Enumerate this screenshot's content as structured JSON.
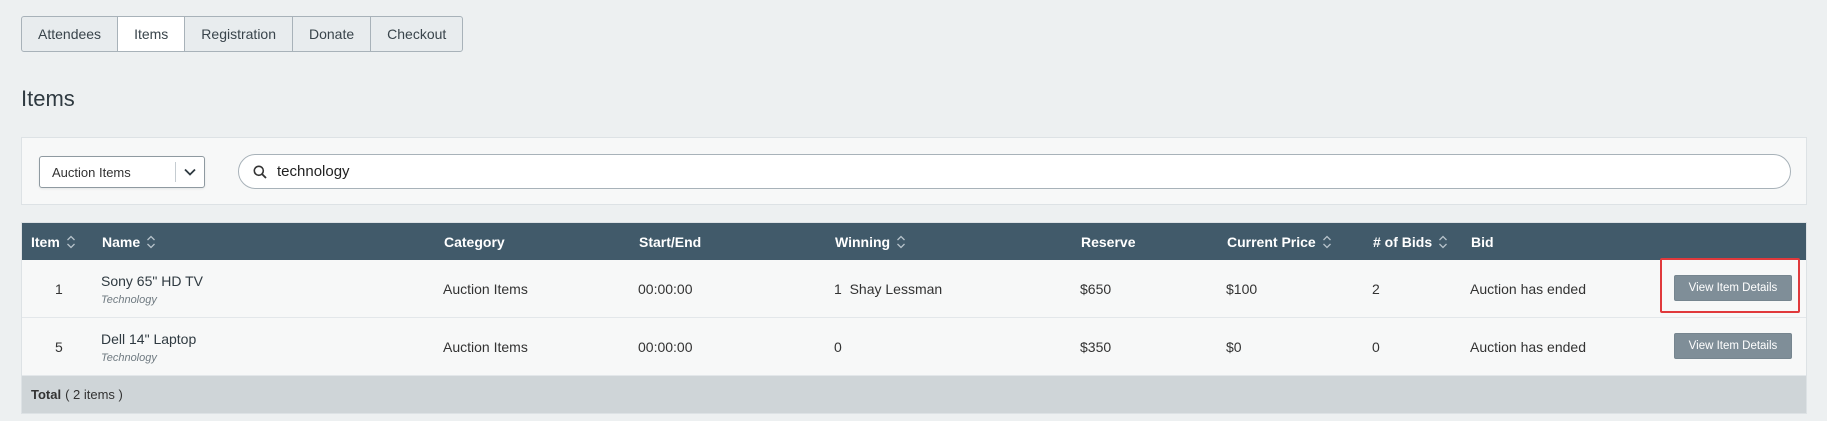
{
  "tabs": [
    {
      "label": "Attendees",
      "active": false
    },
    {
      "label": "Items",
      "active": true
    },
    {
      "label": "Registration",
      "active": false
    },
    {
      "label": "Donate",
      "active": false
    },
    {
      "label": "Checkout",
      "active": false
    }
  ],
  "page_title": "Items",
  "filter": {
    "type_select": "Auction Items",
    "search_value": "technology"
  },
  "table": {
    "columns": {
      "item": "Item",
      "name": "Name",
      "category": "Category",
      "start_end": "Start/End",
      "winning": "Winning",
      "reserve": "Reserve",
      "current_price": "Current Price",
      "bids": "# of Bids",
      "bid": "Bid"
    },
    "rows": [
      {
        "item": "1",
        "name": "Sony 65\" HD TV",
        "subcategory": "Technology",
        "category": "Auction Items",
        "start_end": "00:00:00",
        "winning": "1  Shay Lessman",
        "reserve": "$650",
        "current_price": "$100",
        "bids": "2",
        "bid_status": "Auction has ended",
        "action": "View Item Details"
      },
      {
        "item": "5",
        "name": "Dell 14\" Laptop",
        "subcategory": "Technology",
        "category": "Auction Items",
        "start_end": "00:00:00",
        "winning": "0",
        "reserve": "$350",
        "current_price": "$0",
        "bids": "0",
        "bid_status": "Auction has ended",
        "action": "View Item Details"
      }
    ],
    "footer": {
      "label": "Total",
      "count": "( 2 items )"
    }
  },
  "colors": {
    "header_bg": "#415a6a",
    "button_bg": "#7f8e98",
    "highlight": "#e0393c",
    "page_bg": "#edf0f1"
  }
}
